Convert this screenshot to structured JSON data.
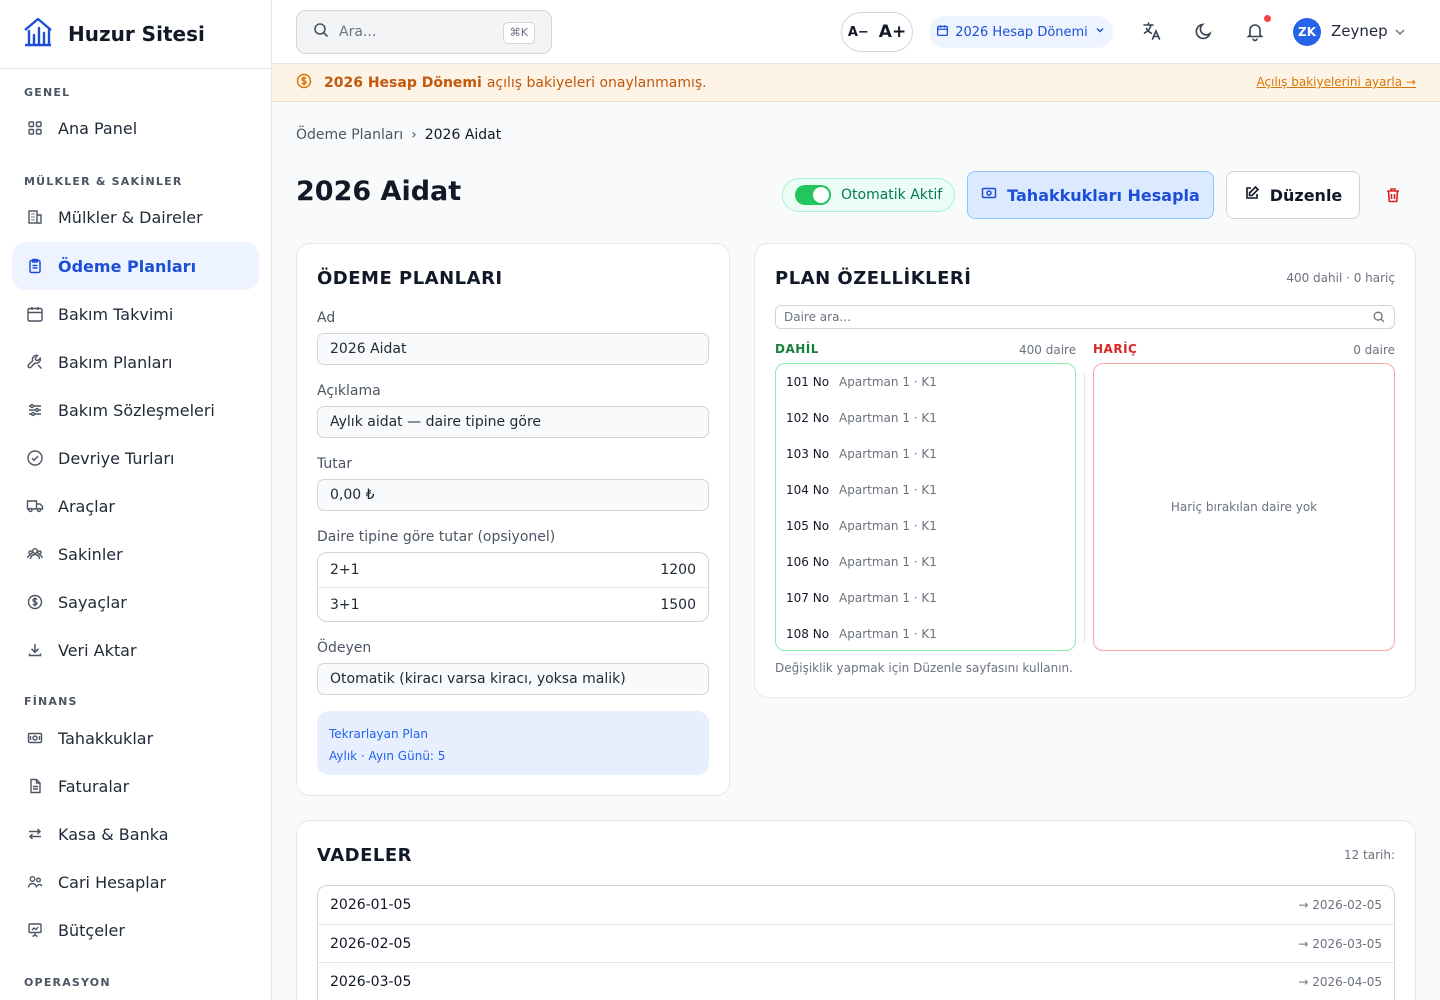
{
  "brand": {
    "name": "Huzur Sitesi"
  },
  "sidebar": {
    "sections": [
      {
        "label": "GENEL"
      },
      {
        "label": "MÜLKLER & SAKİNLER"
      },
      {
        "label": "FİNANS"
      },
      {
        "label": "OPERASYON"
      }
    ],
    "items": [
      {
        "label": "Ana Panel",
        "icon": "grid-icon"
      },
      {
        "label": "Mülkler & Daireler",
        "icon": "building-icon"
      },
      {
        "label": "Ödeme Planları",
        "icon": "clipboard-icon",
        "active": true
      },
      {
        "label": "Bakım Takvimi",
        "icon": "calendar-icon"
      },
      {
        "label": "Bakım Planları",
        "icon": "wrench-icon"
      },
      {
        "label": "Bakım Sözleşmeleri",
        "icon": "sliders-icon"
      },
      {
        "label": "Devriye Turları",
        "icon": "check-circle-icon"
      },
      {
        "label": "Araçlar",
        "icon": "truck-icon"
      },
      {
        "label": "Sakinler",
        "icon": "users-icon"
      },
      {
        "label": "Sayaçlar",
        "icon": "dollar-circle-icon"
      },
      {
        "label": "Veri Aktar",
        "icon": "download-icon"
      },
      {
        "label": "Tahakkuklar",
        "icon": "banknote-icon"
      },
      {
        "label": "Faturalar",
        "icon": "file-icon"
      },
      {
        "label": "Kasa & Banka",
        "icon": "transfer-icon"
      },
      {
        "label": "Cari Hesaplar",
        "icon": "user-group-icon"
      },
      {
        "label": "Bütçeler",
        "icon": "presentation-icon"
      }
    ]
  },
  "header": {
    "search_placeholder": "Ara...",
    "search_shortcut": "⌘K",
    "font_decrease": "A−",
    "font_increase": "A+",
    "period": "2026 Hesap Dönemi",
    "user_initials": "ZK",
    "user_name": "Zeynep"
  },
  "banner": {
    "strong": "2026 Hesap Dönemi",
    "text": "açılış bakiyeleri onaylanmamış.",
    "link": "Açılış bakiyelerini ayarla →"
  },
  "breadcrumb": {
    "parent": "Ödeme Planları",
    "separator": "›",
    "current": "2026 Aidat"
  },
  "page": {
    "title": "2026 Aidat",
    "toggle_label": "Otomatik Aktif",
    "calculate_button": "Tahakkukları Hesapla",
    "edit_button": "Düzenle"
  },
  "plan_form": {
    "title": "ÖDEME PLANLARI",
    "name_label": "Ad",
    "name_value": "2026 Aidat",
    "description_label": "Açıklama",
    "description_value": "Aylık aidat — daire tipine göre",
    "amount_label": "Tutar",
    "amount_value": "0,00 ₺",
    "type_amount_label": "Daire tipine göre tutar (opsiyonel)",
    "type_amounts": [
      {
        "type": "2+1",
        "amount": "1200"
      },
      {
        "type": "3+1",
        "amount": "1500"
      }
    ],
    "payer_label": "Ödeyen",
    "payer_value": "Otomatik (kiracı varsa kiracı, yoksa malik)",
    "recurring_title": "Tekrarlayan Plan",
    "recurring_detail": "Aylık · Ayın Günü: 5"
  },
  "plan_props": {
    "title": "PLAN ÖZELLİKLERİ",
    "summary": "400 dahil · 0 hariç",
    "search_placeholder": "Daire ara...",
    "included_label": "DAHİL",
    "included_count": "400 daire",
    "excluded_label": "HARİÇ",
    "excluded_count": "0 daire",
    "included_units": [
      {
        "no": "101 No",
        "location": "Apartman 1 · K1"
      },
      {
        "no": "102 No",
        "location": "Apartman 1 · K1"
      },
      {
        "no": "103 No",
        "location": "Apartman 1 · K1"
      },
      {
        "no": "104 No",
        "location": "Apartman 1 · K1"
      },
      {
        "no": "105 No",
        "location": "Apartman 1 · K1"
      },
      {
        "no": "106 No",
        "location": "Apartman 1 · K1"
      },
      {
        "no": "107 No",
        "location": "Apartman 1 · K1"
      },
      {
        "no": "108 No",
        "location": "Apartman 1 · K1"
      }
    ],
    "excluded_empty": "Hariç bırakılan daire yok",
    "hint": "Değişiklik yapmak için Düzenle sayfasını kullanın."
  },
  "due_dates": {
    "title": "VADELER",
    "count": "12 tarih:",
    "rows": [
      {
        "date": "2026-01-05",
        "next": "→ 2026-02-05"
      },
      {
        "date": "2026-02-05",
        "next": "→ 2026-03-05"
      },
      {
        "date": "2026-03-05",
        "next": "→ 2026-04-05"
      }
    ]
  },
  "colors": {
    "accent": "#1d4ed8",
    "active_bg": "#eef4ff",
    "success": "#22c55e",
    "included_green": "#15803d",
    "excluded_red": "#dc2626",
    "warning": "#c2580c"
  }
}
